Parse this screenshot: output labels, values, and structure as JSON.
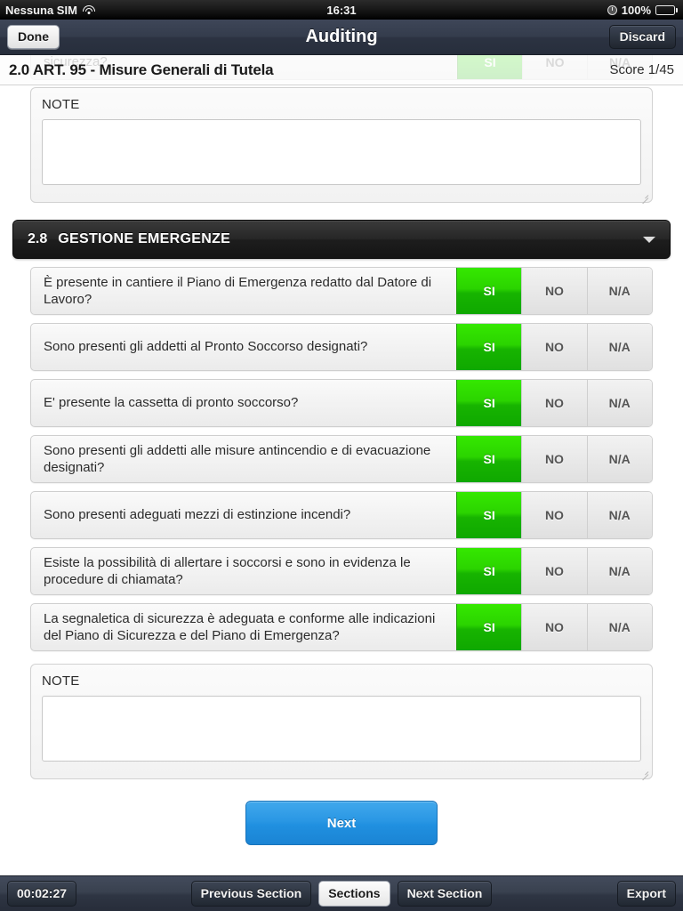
{
  "statusbar": {
    "carrier": "Nessuna SIM",
    "wifi_icon": "wifi-icon",
    "time": "16:31",
    "alarm_icon": "clock-icon",
    "battery_percent": "100%",
    "battery_icon": "battery-icon"
  },
  "navbar": {
    "done_label": "Done",
    "title": "Auditing",
    "discard_label": "Discard"
  },
  "sticky": {
    "section_title": "2.0 ART. 95 - Misure Generali di Tutela",
    "score": "Score 1/45"
  },
  "ghost_row": {
    "question": "sicurezza?",
    "options": [
      "SI",
      "NO",
      "N/A"
    ],
    "selected": "SI"
  },
  "note_top": {
    "label": "NOTE",
    "value": "",
    "placeholder": ""
  },
  "section": {
    "number": "2.8",
    "title": "GESTIONE EMERGENZE",
    "collapse_icon": "chevron-down-icon"
  },
  "options": [
    "SI",
    "NO",
    "N/A"
  ],
  "questions": [
    {
      "text": "È presente in cantiere il Piano di Emergenza redatto dal Datore di Lavoro?",
      "selected": "SI"
    },
    {
      "text": "Sono presenti gli addetti al Pronto Soccorso designati?",
      "selected": "SI"
    },
    {
      "text": "E' presente la cassetta di pronto soccorso?",
      "selected": "SI"
    },
    {
      "text": "Sono presenti gli addetti alle misure antincendio e di evacuazione designati?",
      "selected": "SI"
    },
    {
      "text": "Sono presenti adeguati mezzi di estinzione incendi?",
      "selected": "SI"
    },
    {
      "text": "Esiste la possibilità di allertare i soccorsi e sono in evidenza le procedure di chiamata?",
      "selected": "SI"
    },
    {
      "text": "La segnaletica di sicurezza è adeguata e conforme alle indicazioni del Piano di Sicurezza e del Piano di Emergenza?",
      "selected": "SI"
    }
  ],
  "note_bottom": {
    "label": "NOTE",
    "value": "",
    "placeholder": ""
  },
  "next_button": {
    "label": "Next"
  },
  "toolbar": {
    "timer": "00:02:27",
    "previous_section": "Previous Section",
    "sections": "Sections",
    "next_section": "Next Section",
    "export": "Export"
  },
  "colors": {
    "accent_green": "#23cc00",
    "accent_blue": "#2a97e4",
    "navbar": "#343c4c",
    "section_header": "#1d1d1d"
  }
}
